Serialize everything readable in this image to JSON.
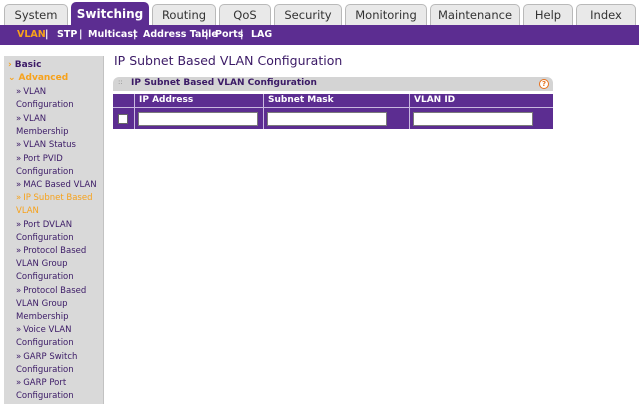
{
  "top_tabs": [
    "System",
    "Switching",
    "Routing",
    "QoS",
    "Security",
    "Monitoring",
    "Maintenance",
    "Help",
    "Index"
  ],
  "active_tab": "Switching",
  "sub_nav": [
    "VLAN",
    "STP",
    "Multicast",
    "Address Table",
    "Ports",
    "LAG"
  ],
  "active_sub": "VLAN",
  "sidebar": {
    "basic": "Basic",
    "advanced": "Advanced",
    "items": [
      [
        "VLAN",
        "Configuration"
      ],
      [
        "VLAN",
        "Membership"
      ],
      [
        "VLAN Status"
      ],
      [
        "Port PVID",
        "Configuration"
      ],
      [
        "MAC Based VLAN"
      ],
      [
        "IP Subnet Based",
        "VLAN"
      ],
      [
        "Port DVLAN",
        "Configuration"
      ],
      [
        "Protocol Based",
        "VLAN Group",
        "Configuration"
      ],
      [
        "Protocol Based",
        "VLAN Group",
        "Membership"
      ],
      [
        "Voice VLAN",
        "Configuration"
      ],
      [
        "GARP Switch",
        "Configuration"
      ],
      [
        "GARP Port",
        "Configuration"
      ]
    ]
  },
  "page_title": "IP Subnet Based VLAN Configuration",
  "panel": {
    "title": "IP Subnet Based VLAN Configuration",
    "help": "?",
    "columns": [
      "IP Address",
      "Subnet Mask",
      "VLAN ID"
    ],
    "row": {
      "ip_address": "",
      "subnet_mask": "",
      "vlan_id": ""
    }
  },
  "colors": {
    "brand": "#5c2d91",
    "accent": "#f7a21b",
    "tab_bg": "#e9e9e9",
    "sidebar_bg": "#d9d9d9"
  }
}
